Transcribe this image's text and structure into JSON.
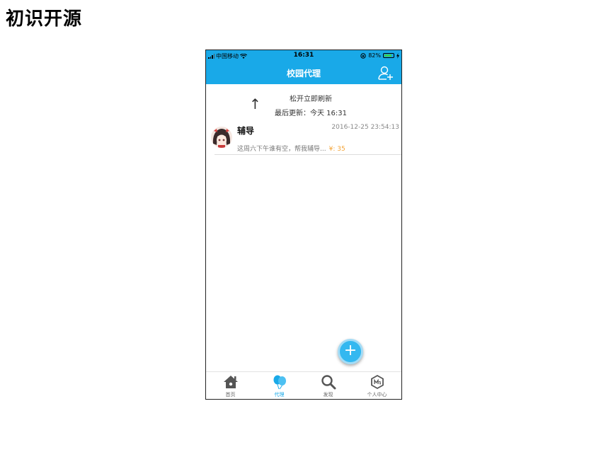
{
  "slide": {
    "title": "初识开源"
  },
  "status_bar": {
    "carrier": "中国移动",
    "time": "16:31",
    "battery": "82%",
    "battery_level": 0.82
  },
  "nav": {
    "title": "校园代理",
    "add_user_icon": "add-user-icon"
  },
  "refresh": {
    "message": "松开立即刷新",
    "last_updated": "最后更新：今天 16:31",
    "arrow": "↑"
  },
  "items": [
    {
      "name": "辅导",
      "time": "2016-12-25 23:54:13",
      "description": "这周六下午谁有空，帮我辅导...",
      "price": "¥: 35"
    }
  ],
  "fab": {
    "label": "+"
  },
  "tabs": [
    {
      "label": "首页",
      "icon": "home-icon"
    },
    {
      "label": "代理",
      "icon": "balloon-icon",
      "active": true
    },
    {
      "label": "发现",
      "icon": "search-icon"
    },
    {
      "label": "个人中心",
      "icon": "profile-badge-icon"
    }
  ],
  "colors": {
    "primary": "#19a9e8",
    "price": "#f3a234",
    "fab": "#34b8f0"
  }
}
